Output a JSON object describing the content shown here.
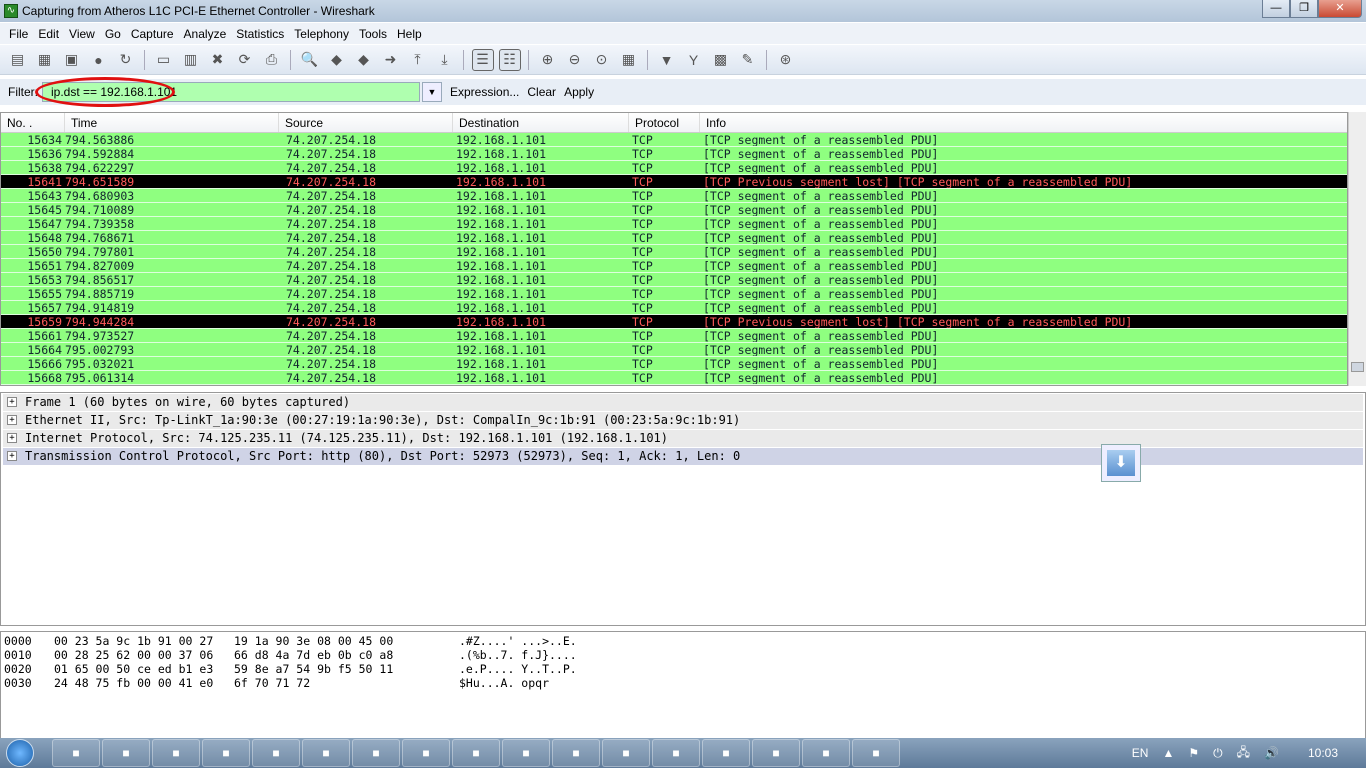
{
  "window": {
    "title": "Capturing from Atheros L1C PCI-E Ethernet Controller - Wireshark",
    "minimize": "—",
    "maximize": "❐",
    "close": "✕"
  },
  "menu": [
    "File",
    "Edit",
    "View",
    "Go",
    "Capture",
    "Analyze",
    "Statistics",
    "Telephony",
    "Tools",
    "Help"
  ],
  "toolbar": [
    "interfaces-icon",
    "options-icon",
    "start-icon",
    "stop-icon",
    "restart-icon",
    "open-icon",
    "save-icon",
    "close-file-icon",
    "reload-icon",
    "print-icon",
    "find-icon",
    "back-icon",
    "forward-icon",
    "goto-icon",
    "first-icon",
    "last-icon",
    "colorize-icon",
    "autoscroll-icon",
    "zoom-in-icon",
    "zoom-out-icon",
    "zoom-normal-icon",
    "resize-columns-icon",
    "capture-filters-icon",
    "display-filters-icon",
    "coloring-rules-icon",
    "preferences-icon",
    "help-icon"
  ],
  "filter": {
    "label": "Filter:",
    "value": "ip.dst == 192.168.1.101",
    "expression": "Expression...",
    "clear": "Clear",
    "apply": "Apply",
    "valid_color": "#afffaf"
  },
  "packet_list": {
    "columns": [
      "No. .",
      "Time",
      "Source",
      "Destination",
      "Protocol",
      "Info"
    ],
    "rows": [
      [
        "15634",
        "794.563886",
        "74.207.254.18",
        "192.168.1.101",
        "TCP",
        "[TCP segment of a reassembled PDU]"
      ],
      [
        "15636",
        "794.592884",
        "74.207.254.18",
        "192.168.1.101",
        "TCP",
        "[TCP segment of a reassembled PDU]"
      ],
      [
        "15638",
        "794.622297",
        "74.207.254.18",
        "192.168.1.101",
        "TCP",
        "[TCP segment of a reassembled PDU]"
      ],
      [
        "15641",
        "794.651589",
        "74.207.254.18",
        "192.168.1.101",
        "TCP",
        "[TCP Previous segment lost] [TCP segment of a reassembled PDU]"
      ],
      [
        "15643",
        "794.680903",
        "74.207.254.18",
        "192.168.1.101",
        "TCP",
        "[TCP segment of a reassembled PDU]"
      ],
      [
        "15645",
        "794.710089",
        "74.207.254.18",
        "192.168.1.101",
        "TCP",
        "[TCP segment of a reassembled PDU]"
      ],
      [
        "15647",
        "794.739358",
        "74.207.254.18",
        "192.168.1.101",
        "TCP",
        "[TCP segment of a reassembled PDU]"
      ],
      [
        "15648",
        "794.768671",
        "74.207.254.18",
        "192.168.1.101",
        "TCP",
        "[TCP segment of a reassembled PDU]"
      ],
      [
        "15650",
        "794.797801",
        "74.207.254.18",
        "192.168.1.101",
        "TCP",
        "[TCP segment of a reassembled PDU]"
      ],
      [
        "15651",
        "794.827009",
        "74.207.254.18",
        "192.168.1.101",
        "TCP",
        "[TCP segment of a reassembled PDU]"
      ],
      [
        "15653",
        "794.856517",
        "74.207.254.18",
        "192.168.1.101",
        "TCP",
        "[TCP segment of a reassembled PDU]"
      ],
      [
        "15655",
        "794.885719",
        "74.207.254.18",
        "192.168.1.101",
        "TCP",
        "[TCP segment of a reassembled PDU]"
      ],
      [
        "15657",
        "794.914819",
        "74.207.254.18",
        "192.168.1.101",
        "TCP",
        "[TCP segment of a reassembled PDU]"
      ],
      [
        "15659",
        "794.944284",
        "74.207.254.18",
        "192.168.1.101",
        "TCP",
        "[TCP Previous segment lost] [TCP segment of a reassembled PDU]"
      ],
      [
        "15661",
        "794.973527",
        "74.207.254.18",
        "192.168.1.101",
        "TCP",
        "[TCP segment of a reassembled PDU]"
      ],
      [
        "15664",
        "795.002793",
        "74.207.254.18",
        "192.168.1.101",
        "TCP",
        "[TCP segment of a reassembled PDU]"
      ],
      [
        "15666",
        "795.032021",
        "74.207.254.18",
        "192.168.1.101",
        "TCP",
        "[TCP segment of a reassembled PDU]"
      ],
      [
        "15668",
        "795.061314",
        "74.207.254.18",
        "192.168.1.101",
        "TCP",
        "[TCP segment of a reassembled PDU]"
      ]
    ],
    "colors": {
      "normal_bg": "#8fff80",
      "error_bg": "#000000",
      "error_fg": "#ff5c5c"
    }
  },
  "details": [
    "Frame 1 (60 bytes on wire, 60 bytes captured)",
    "Ethernet II, Src: Tp-LinkT_1a:90:3e (00:27:19:1a:90:3e), Dst: CompalIn_9c:1b:91 (00:23:5a:9c:1b:91)",
    "Internet Protocol, Src: 74.125.235.11 (74.125.235.11), Dst: 192.168.1.101 (192.168.1.101)",
    "Transmission Control Protocol, Src Port: http (80), Dst Port: 52973 (52973), Seq: 1, Ack: 1, Len: 0"
  ],
  "hex": [
    [
      "0000",
      "00 23 5a 9c 1b 91 00 27",
      "19 1a 90 3e 08 00 45 00",
      ".#Z....' ...>..E."
    ],
    [
      "0010",
      "00 28 25 62 00 00 37 06",
      "66 d8 4a 7d eb 0b c0 a8",
      ".(%b..7. f.J}...."
    ],
    [
      "0020",
      "01 65 00 50 ce ed b1 e3",
      "59 8e a7 54 9b f5 50 11",
      ".e.P.... Y..T..P."
    ],
    [
      "0030",
      "24 48 75 fb 00 00 41 e0",
      "6f 70 71 72",
      "$Hu...A. opqr"
    ]
  ],
  "taskbar": {
    "apps": [
      "explorer",
      "virtualbox",
      "avast",
      "opera",
      "app",
      "app",
      "app",
      "firefox",
      "fireworks",
      "cmd",
      "notepad",
      "app",
      "wireshark",
      "app",
      "app",
      "app",
      "app"
    ],
    "lang": "EN",
    "time": "10:03"
  }
}
